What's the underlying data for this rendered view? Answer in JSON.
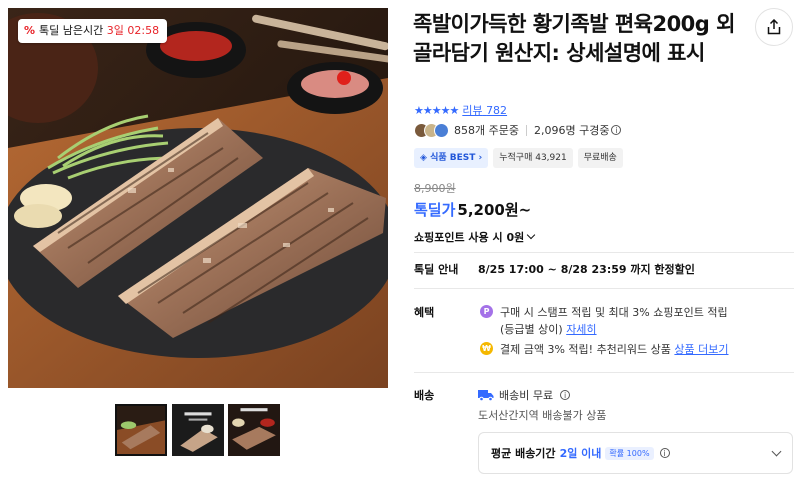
{
  "timer": {
    "icon": "percent-icon",
    "label": "톡딜 남은시간",
    "days": "3일",
    "time": "02:58"
  },
  "product": {
    "title": "족발이가득한 황기족발 편육200g 외 골라담기 원산지: 상세설명에 표시",
    "rating_stars": "★★★★★",
    "rating": 5,
    "review_label": "리뷰",
    "review_count": "782",
    "order_count": "858개 주문중",
    "subscribers": "2,096명 구경중",
    "badges": {
      "category": "식품 BEST",
      "cumulative": "누적구매 43,921",
      "shipping": "무료배송"
    },
    "original_price": "8,900원",
    "price_label": "톡딜가",
    "price": "5,200원~",
    "point_text": "쇼핑포인트 사용 시",
    "point_value": "0원"
  },
  "deal": {
    "label": "톡딜 안내",
    "period": "8/25 17:00 ~ 8/28 23:59 까지 한정할인"
  },
  "benefits": {
    "label": "혜택",
    "items": [
      {
        "icon": "point-coin-icon",
        "text1": "구매 시 스탬프 적립 및 최대 3% 쇼핑포인트 적립",
        "text2": "(등급별 상이)",
        "link": "자세히"
      },
      {
        "icon": "won-coin-icon",
        "text": "결제 금액 3% 적립! 추천리워드 상품",
        "link": "상품 더보기"
      }
    ]
  },
  "shipping": {
    "label": "배송",
    "fee": "배송비 무료",
    "note": "도서산간지역 배송불가 상품",
    "eta_label": "평균 배송기간",
    "eta_value": "2일 이내",
    "eta_pill": "확률 100%"
  },
  "colors": {
    "accent": "#346aff",
    "deal_red": "#e8242a",
    "point_purple": "#a472e8",
    "won_yellow": "#f5b800"
  }
}
